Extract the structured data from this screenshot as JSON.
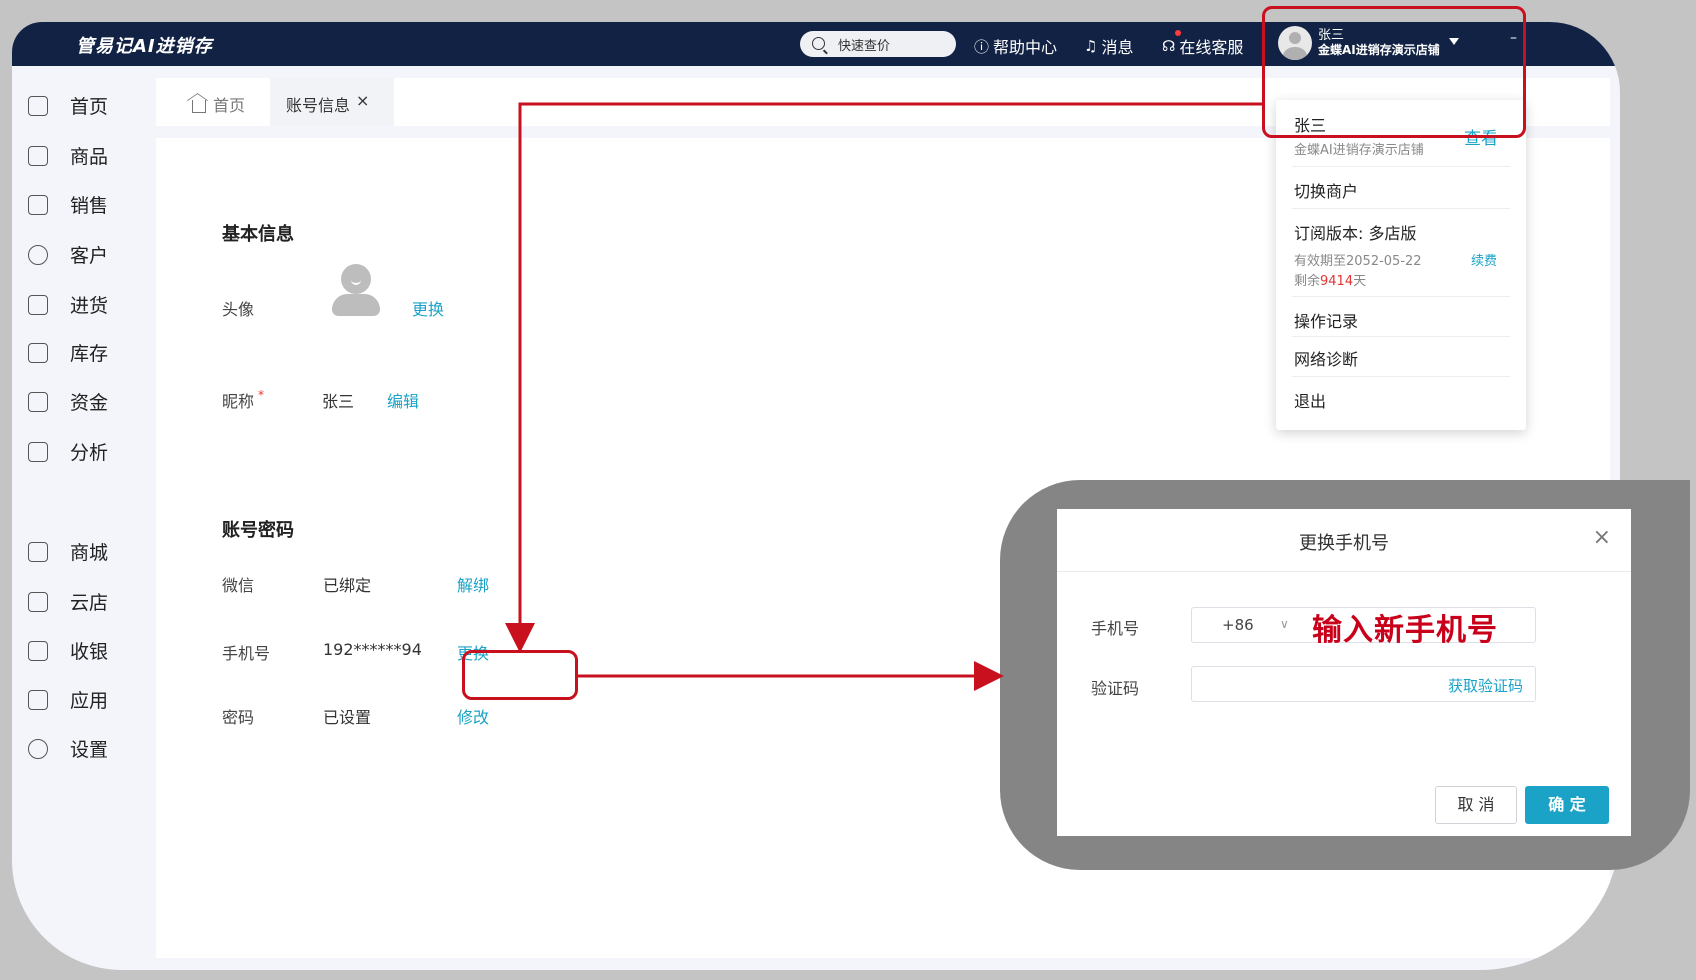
{
  "app": {
    "logo": "管易记AI进销存"
  },
  "topbar": {
    "search_label": "快速查价",
    "help_label": "帮助中心",
    "messages_label": "消息",
    "service_label": "在线客服",
    "user_name": "张三",
    "store_name": "金蝶AI进销存演示店铺",
    "minimize": "–"
  },
  "sidebar": {
    "items": [
      {
        "label": "首页",
        "icon": "home-icon"
      },
      {
        "label": "商品",
        "icon": "bag-icon"
      },
      {
        "label": "销售",
        "icon": "clipboard-icon"
      },
      {
        "label": "客户",
        "icon": "user-icon"
      },
      {
        "label": "进货",
        "icon": "stock-in-icon"
      },
      {
        "label": "库存",
        "icon": "warehouse-icon"
      },
      {
        "label": "资金",
        "icon": "wallet-icon"
      },
      {
        "label": "分析",
        "icon": "chart-icon"
      },
      {
        "label": "商城",
        "icon": "mall-icon"
      },
      {
        "label": "云店",
        "icon": "cloud-store-icon"
      },
      {
        "label": "收银",
        "icon": "cashier-icon"
      },
      {
        "label": "应用",
        "icon": "apps-icon"
      },
      {
        "label": "设置",
        "icon": "gear-icon"
      }
    ]
  },
  "tabs": {
    "home": "首页",
    "active": "账号信息",
    "close": "×"
  },
  "content": {
    "basic_title": "基本信息",
    "avatar_label": "头像",
    "avatar_action": "更换",
    "nickname_label": "昵称",
    "required_mark": "*",
    "nickname_value": "张三",
    "nickname_action": "编辑",
    "account_title": "账号密码",
    "wechat_label": "微信",
    "wechat_value": "已绑定",
    "wechat_action": "解绑",
    "phone_label": "手机号",
    "phone_value": "192******94",
    "phone_action": "更换",
    "password_label": "密码",
    "password_value": "已设置",
    "password_action": "修改"
  },
  "dropdown": {
    "user_name": "张三",
    "store_name": "金蝶AI进销存演示店铺",
    "view": "查看",
    "switch_merchant": "切换商户",
    "plan": "订阅版本: 多店版",
    "expiry": "有效期至2052-05-22",
    "renew": "续费",
    "remaining_prefix": "剩余",
    "remaining_days": "9414",
    "remaining_suffix": "天",
    "operation_log": "操作记录",
    "network_diagnosis": "网络诊断",
    "logout": "退出"
  },
  "modal": {
    "title": "更换手机号",
    "close": "×",
    "phone_label": "手机号",
    "country_code": "+86",
    "caret": "∨",
    "phone_hint": "输入新手机号",
    "code_label": "验证码",
    "get_code": "获取验证码",
    "cancel": "取 消",
    "confirm": "确 定"
  },
  "colors": {
    "topbar": "#112244",
    "accent": "#1ba3c7",
    "annotation": "#c8101e",
    "danger": "#e33333"
  }
}
